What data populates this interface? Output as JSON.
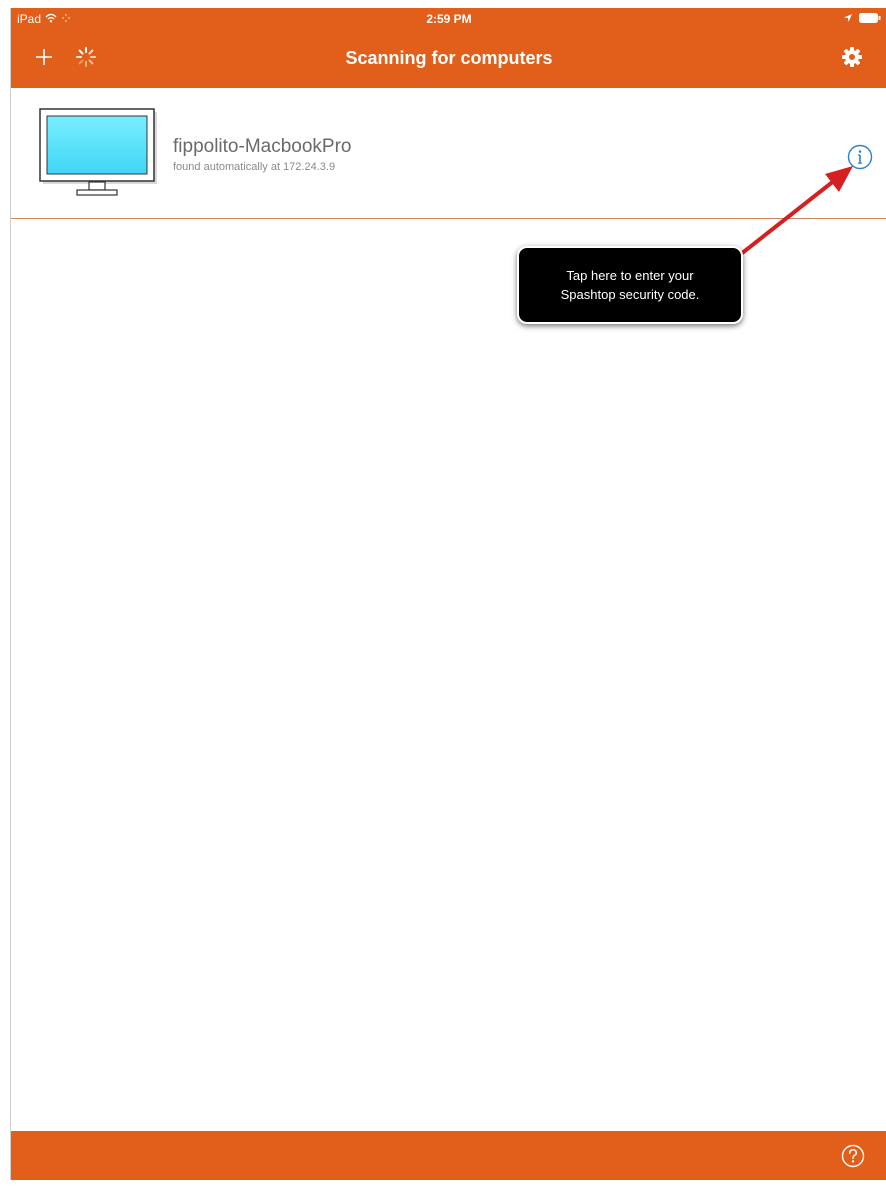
{
  "statusbar": {
    "device": "iPad",
    "time": "2:59 PM",
    "icons": [
      "wifi-icon",
      "activity-icon",
      "location-icon",
      "battery-icon"
    ]
  },
  "navbar": {
    "title": "Scanning for computers",
    "left_icons": [
      "plus-icon",
      "spinner-icon"
    ],
    "right_icon": "gear-icon"
  },
  "computers": [
    {
      "name": "fippolito-MacbookPro",
      "detail": "found automatically at 172.24.3.9",
      "icon": "monitor-icon",
      "action_icon": "info-icon"
    }
  ],
  "callout": {
    "line1": "Tap here to enter your",
    "line2": "Spashtop security code.",
    "arrow_color": "#d42020"
  },
  "bottombar": {
    "icon": "help-icon"
  },
  "colors": {
    "accent": "#e15e1b",
    "info_blue": "#2a7fd4",
    "screen": "#5fe6fb"
  }
}
